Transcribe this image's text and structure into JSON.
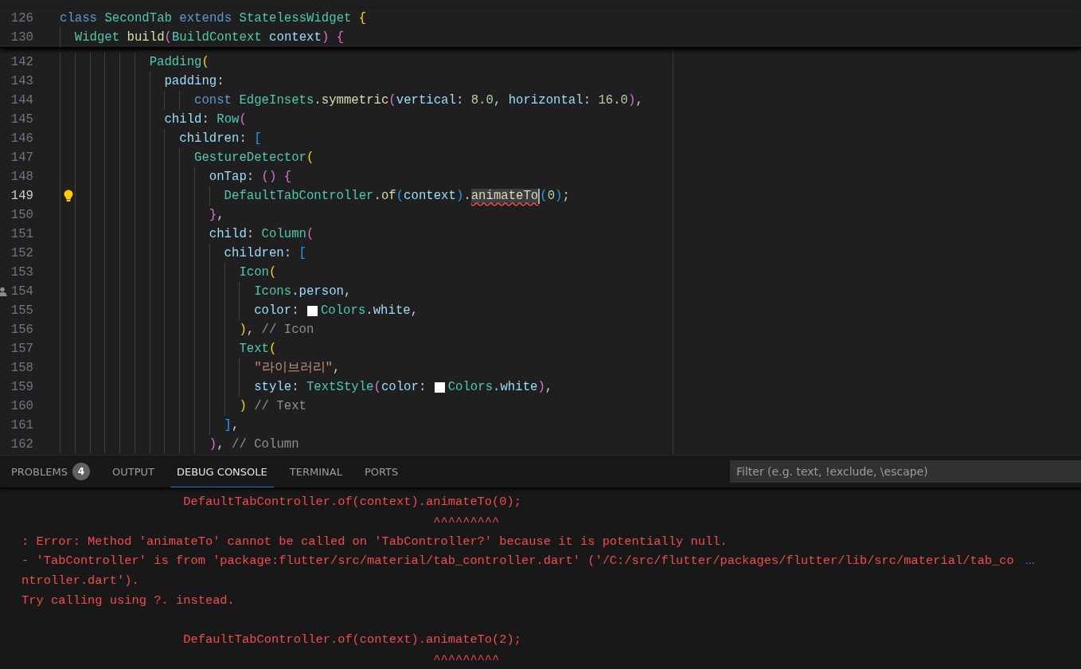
{
  "sticky_lines": [
    {
      "number": "126",
      "tokens": [
        {
          "text": "class ",
          "kind": "kw"
        },
        {
          "text": "SecondTab ",
          "kind": "type"
        },
        {
          "text": "extends ",
          "kind": "kw"
        },
        {
          "text": "StatelessWidget ",
          "kind": "type"
        },
        {
          "text": "{",
          "kind": "b1"
        }
      ]
    },
    {
      "number": "130",
      "tokens": [
        {
          "text": "  Widget ",
          "kind": "type"
        },
        {
          "text": "build",
          "kind": "fn"
        },
        {
          "text": "(",
          "kind": "b2"
        },
        {
          "text": "BuildContext ",
          "kind": "type"
        },
        {
          "text": "context",
          "kind": "prop"
        },
        {
          "text": ") ",
          "kind": "b2"
        },
        {
          "text": "{",
          "kind": "b2"
        }
      ]
    }
  ],
  "lines": [
    {
      "number": "142",
      "current": false,
      "tokens": [
        {
          "text": "            Padding",
          "kind": "type"
        },
        {
          "text": "(",
          "kind": "b1"
        }
      ]
    },
    {
      "number": "143",
      "current": false,
      "tokens": [
        {
          "text": "              padding",
          "kind": "prop"
        },
        {
          "text": ":",
          "kind": "p"
        }
      ]
    },
    {
      "number": "144",
      "current": false,
      "tokens": [
        {
          "text": "                  const ",
          "kind": "kw"
        },
        {
          "text": "EdgeInsets",
          "kind": "type"
        },
        {
          "text": ".",
          "kind": "p"
        },
        {
          "text": "symmetric",
          "kind": "fn"
        },
        {
          "text": "(",
          "kind": "b2"
        },
        {
          "text": "vertical",
          "kind": "prop"
        },
        {
          "text": ": ",
          "kind": "p"
        },
        {
          "text": "8.0",
          "kind": "num"
        },
        {
          "text": ", ",
          "kind": "p"
        },
        {
          "text": "horizontal",
          "kind": "prop"
        },
        {
          "text": ": ",
          "kind": "p"
        },
        {
          "text": "16.0",
          "kind": "num"
        },
        {
          "text": ")",
          "kind": "b2"
        },
        {
          "text": ",",
          "kind": "p"
        }
      ]
    },
    {
      "number": "145",
      "current": false,
      "tokens": [
        {
          "text": "              child",
          "kind": "prop"
        },
        {
          "text": ": ",
          "kind": "p"
        },
        {
          "text": "Row",
          "kind": "type"
        },
        {
          "text": "(",
          "kind": "b2"
        }
      ]
    },
    {
      "number": "146",
      "current": false,
      "tokens": [
        {
          "text": "                children",
          "kind": "prop"
        },
        {
          "text": ": ",
          "kind": "p"
        },
        {
          "text": "[",
          "kind": "b3"
        }
      ]
    },
    {
      "number": "147",
      "current": false,
      "tokens": [
        {
          "text": "                  GestureDetector",
          "kind": "type"
        },
        {
          "text": "(",
          "kind": "b1"
        }
      ]
    },
    {
      "number": "148",
      "current": false,
      "tokens": [
        {
          "text": "                    onTap",
          "kind": "prop"
        },
        {
          "text": ": ",
          "kind": "p"
        },
        {
          "text": "() {",
          "kind": "b2"
        }
      ]
    },
    {
      "number": "149",
      "current": true,
      "lightbulb": true,
      "tokens": [
        {
          "text": "                      DefaultTabController",
          "kind": "type"
        },
        {
          "text": ".",
          "kind": "p"
        },
        {
          "text": "of",
          "kind": "fn"
        },
        {
          "text": "(",
          "kind": "b3"
        },
        {
          "text": "context",
          "kind": "prop"
        },
        {
          "text": ")",
          "kind": "b3"
        },
        {
          "text": ".",
          "kind": "p"
        },
        {
          "text": "animateTo",
          "kind": "fn",
          "error": true
        },
        {
          "text": "(",
          "kind": "b3"
        },
        {
          "text": "0",
          "kind": "num"
        },
        {
          "text": ")",
          "kind": "b3"
        },
        {
          "text": ";",
          "kind": "p"
        }
      ]
    },
    {
      "number": "150",
      "current": false,
      "tokens": [
        {
          "text": "                    }",
          "kind": "b2"
        },
        {
          "text": ",",
          "kind": "p"
        }
      ]
    },
    {
      "number": "151",
      "current": false,
      "tokens": [
        {
          "text": "                    child",
          "kind": "prop"
        },
        {
          "text": ": ",
          "kind": "p"
        },
        {
          "text": "Column",
          "kind": "type"
        },
        {
          "text": "(",
          "kind": "b2"
        }
      ]
    },
    {
      "number": "152",
      "current": false,
      "tokens": [
        {
          "text": "                      children",
          "kind": "prop"
        },
        {
          "text": ": ",
          "kind": "p"
        },
        {
          "text": "[",
          "kind": "b3"
        }
      ]
    },
    {
      "number": "153",
      "current": false,
      "tokens": [
        {
          "text": "                        Icon",
          "kind": "type"
        },
        {
          "text": "(",
          "kind": "b1"
        }
      ]
    },
    {
      "number": "154",
      "current": false,
      "author_mark": true,
      "tokens": [
        {
          "text": "                          Icons",
          "kind": "type"
        },
        {
          "text": ".",
          "kind": "p"
        },
        {
          "text": "person",
          "kind": "prop"
        },
        {
          "text": ",",
          "kind": "p"
        }
      ]
    },
    {
      "number": "155",
      "current": false,
      "tokens": [
        {
          "text": "                          color",
          "kind": "prop"
        },
        {
          "text": ": ",
          "kind": "p"
        },
        {
          "kind": "swatch",
          "color": "#ffffff"
        },
        {
          "text": "Colors",
          "kind": "type"
        },
        {
          "text": ".",
          "kind": "p"
        },
        {
          "text": "white",
          "kind": "prop"
        },
        {
          "text": ",",
          "kind": "p"
        }
      ]
    },
    {
      "number": "156",
      "current": false,
      "tokens": [
        {
          "text": "                        )",
          "kind": "b1"
        },
        {
          "text": ", ",
          "kind": "p"
        },
        {
          "text": "// Icon",
          "kind": "cmt"
        }
      ]
    },
    {
      "number": "157",
      "current": false,
      "tokens": [
        {
          "text": "                        Text",
          "kind": "type"
        },
        {
          "text": "(",
          "kind": "b1"
        }
      ]
    },
    {
      "number": "158",
      "current": false,
      "tokens": [
        {
          "text": "                          \"라이브러리\"",
          "kind": "str"
        },
        {
          "text": ",",
          "kind": "p"
        }
      ]
    },
    {
      "number": "159",
      "current": false,
      "tokens": [
        {
          "text": "                          style",
          "kind": "prop"
        },
        {
          "text": ": ",
          "kind": "p"
        },
        {
          "text": "TextStyle",
          "kind": "type"
        },
        {
          "text": "(",
          "kind": "b2"
        },
        {
          "text": "color",
          "kind": "prop"
        },
        {
          "text": ": ",
          "kind": "p"
        },
        {
          "kind": "swatch",
          "color": "#ffffff"
        },
        {
          "text": "Colors",
          "kind": "type"
        },
        {
          "text": ".",
          "kind": "p"
        },
        {
          "text": "white",
          "kind": "prop"
        },
        {
          "text": ")",
          "kind": "b2"
        },
        {
          "text": ",",
          "kind": "p"
        }
      ]
    },
    {
      "number": "160",
      "current": false,
      "tokens": [
        {
          "text": "                        ) ",
          "kind": "b1"
        },
        {
          "text": "// Text",
          "kind": "cmt"
        }
      ]
    },
    {
      "number": "161",
      "current": false,
      "tokens": [
        {
          "text": "                      ]",
          "kind": "b3"
        },
        {
          "text": ",",
          "kind": "p"
        }
      ]
    },
    {
      "number": "162",
      "current": false,
      "tokens": [
        {
          "text": "                    )",
          "kind": "b2"
        },
        {
          "text": ", ",
          "kind": "p"
        },
        {
          "text": "// Column",
          "kind": "cmt"
        }
      ]
    }
  ],
  "panel_tabs": [
    {
      "label": "PROBLEMS",
      "badge": "4",
      "selected": false
    },
    {
      "label": "OUTPUT",
      "selected": false
    },
    {
      "label": "DEBUG CONSOLE",
      "selected": true
    },
    {
      "label": "TERMINAL",
      "selected": false
    },
    {
      "label": "PORTS",
      "selected": false
    }
  ],
  "filter": {
    "placeholder": "Filter (e.g. text, !exclude, \\escape)"
  },
  "console_blocks": [
    {
      "lines": [
        {
          "text": "                      DefaultTabController.of(context).animateTo(0);"
        },
        {
          "text": "                                                        ^^^^^^^^^"
        },
        {
          "text": ": Error: Method 'animateTo' cannot be called on 'TabController?' because it is potentially null."
        },
        {
          "text": "- 'TabController' is from 'package:flutter/src/material/tab_controller.dart' ('/C:/src/flutter/packages/flutter/lib/src/material/tab_co",
          "overflow_mark": "…"
        },
        {
          "text": "ntroller.dart')."
        },
        {
          "text": "Try calling using ?. instead."
        }
      ]
    },
    {
      "lines": [
        {
          "text": "                      DefaultTabController.of(context).animateTo(2);"
        },
        {
          "text": "                                                        ^^^^^^^^^"
        }
      ]
    }
  ]
}
